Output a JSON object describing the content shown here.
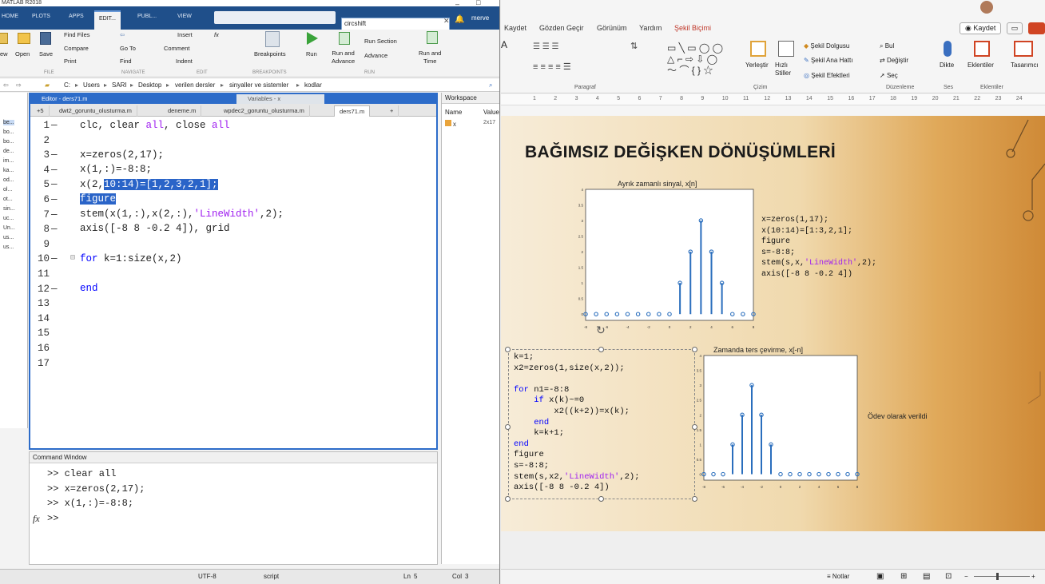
{
  "matlab": {
    "title": "MATLAB R2018",
    "tabs": [
      "HOME",
      "PLOTS",
      "APPS",
      "EDIT...",
      "PUBL...",
      "VIEW"
    ],
    "search_value": "circshift",
    "user": "merve",
    "ribbon": {
      "find_files": "Find Files",
      "compare": "Compare",
      "print": "Print",
      "insert": "Insert",
      "comment": "Comment",
      "indent": "Indent",
      "go_to": "Go To",
      "find": "Find",
      "breakpoints": "Breakpoints",
      "run": "Run",
      "run_and_advance": "Run and\nAdvance",
      "run_section": "Run Section",
      "advance": "Advance",
      "run_and_time": "Run and\nTime",
      "new": "ew",
      "open": "Open",
      "save": "Save",
      "group_file": "FILE",
      "group_navigate": "NAVIGATE",
      "group_edit": "EDIT",
      "group_breakpoints": "BREAKPOINTS",
      "group_run": "RUN"
    },
    "path": [
      "C:",
      "Users",
      "SARI",
      "Desktop",
      "verilen dersler",
      "sinyaller ve sistemler",
      "kodlar"
    ],
    "left_files": [
      "be...",
      "bo...",
      "bo...",
      "de...",
      "im...",
      "ka...",
      "od...",
      "ol...",
      "ot...",
      "sin...",
      "uc...",
      "Un...",
      "us...",
      "us..."
    ],
    "editor": {
      "header": "Editor - ders71.m",
      "variables_header": "Variables - x",
      "tabs": [
        "+5",
        "dwt2_goruntu_olusturma.m",
        "deneme.m",
        "wpdec2_goruntu_olusturma.m",
        "ders71.m",
        "+"
      ],
      "line_numbers": [
        "1",
        "2",
        "3",
        "4",
        "5",
        "6",
        "7",
        "8",
        "9",
        "10",
        "11",
        "12",
        "13",
        "14",
        "15",
        "16",
        "17"
      ],
      "code": {
        "l1_a": "clc, clear ",
        "l1_b": "all",
        "l1_c": ", close ",
        "l1_d": "all",
        "l3": "x=zeros(2,17);",
        "l4": "x(1,:)=-8:8;",
        "l5_a": "x(2,",
        "l5_b": "10:14)=[1,2,3,2,1];",
        "l6": "figure",
        "l7_a": "stem(x(1,:),x(2,:),",
        "l7_b": "'LineWidth'",
        "l7_c": ",2);",
        "l8": "axis([-8 8 -0.2 4]), grid",
        "l10_a": "for",
        "l10_b": " k=1:size(x,2)",
        "l12": "end"
      }
    },
    "workspace": {
      "header": "Workspace",
      "col_name": "Name",
      "col_value": "Value",
      "var_name": "x",
      "var_value": "2x17"
    },
    "command_window": {
      "header": "Command Window",
      "lines": [
        ">> clear all",
        ">> x=zeros(2,17);",
        ">> x(1,:)=-8:8;",
        ">>"
      ],
      "fx": "fx"
    },
    "status": {
      "encoding": "UTF-8",
      "type": "script",
      "ln_label": "Ln",
      "ln_value": "5",
      "col_label": "Col",
      "col_value": "3"
    }
  },
  "powerpoint": {
    "menu": [
      "Kaydet",
      "Gözden Geçir",
      "Görünüm",
      "Yardım",
      "Şekil Biçimi"
    ],
    "save_button": "Kaydet",
    "ribbon": {
      "paragraf": "Paragraf",
      "cizim": "Çizim",
      "duzenleme": "Düzenleme",
      "ses": "Ses",
      "eklentiler_group": "Eklentiler",
      "yerlestir": "Yerleştir",
      "hizli_stiller": "Hızlı\nStiller",
      "sekil_dolgusu": "Şekil Dolgusu",
      "sekil_ana_hatti": "Şekil Ana Hattı",
      "sekil_efektleri": "Şekil Efektleri",
      "bul": "Bul",
      "degistir": "Değiştir",
      "sec": "Seç",
      "dikte": "Dikte",
      "eklentiler": "Eklentiler",
      "tasarimci": "Tasarımcı"
    },
    "ruler": [
      "1",
      "2",
      "3",
      "4",
      "5",
      "6",
      "7",
      "8",
      "9",
      "10",
      "11",
      "12",
      "13",
      "14",
      "15",
      "16",
      "17",
      "18",
      "19",
      "20",
      "21",
      "22",
      "23",
      "24"
    ],
    "slide": {
      "title": "BAĞIMSIZ DEĞİŞKEN DÖNÜŞÜMLERİ",
      "plot1_caption": "Ayrık zamanlı sinyal, x[n]",
      "plot2_caption": "Zamanda ters çevirme, x[-n]",
      "code1": "x=zeros(1,17);\nx(10:14)=[1:3,2,1];\nfigure\ns=-8:8;\nstem(s,x,'LineWidth',2);\naxis([-8 8 -0.2 4])",
      "code2": "k=1;\nx2=zeros(1,size(x,2));\n\nfor n1=-8:8\n    if x(k)~=0\n        x2((k+2))=x(k);\n    end\n    k=k+1;\nend\nfigure\ns=-8:8;\nstem(s,x2,'LineWidth',2);\naxis([-8 8 -0.2 4])",
      "note": "Ödev olarak verildi"
    },
    "status": {
      "notes": "Notlar"
    }
  },
  "chart_data": [
    {
      "type": "scatter",
      "title": "Ayrık zamanlı sinyal, x[n]",
      "x": [
        -8,
        -7,
        -6,
        -5,
        -4,
        -3,
        -2,
        -1,
        0,
        1,
        2,
        3,
        4,
        5,
        6,
        7,
        8
      ],
      "y": [
        0,
        0,
        0,
        0,
        0,
        0,
        0,
        0,
        0,
        1,
        2,
        3,
        2,
        1,
        0,
        0,
        0
      ],
      "xlim": [
        -8,
        8
      ],
      "ylim": [
        -0.2,
        4
      ],
      "yticks": [
        "0",
        "0.5",
        "1",
        "1.5",
        "2",
        "2.5",
        "3",
        "3.5",
        "4"
      ],
      "xticks": [
        "-8",
        "-6",
        "-4",
        "-2",
        "0",
        "2",
        "4",
        "6",
        "8"
      ],
      "color": "#2a6ebd"
    },
    {
      "type": "scatter",
      "title": "Zamanda ters çevirme, x[-n]",
      "x": [
        -8,
        -7,
        -6,
        -5,
        -4,
        -3,
        -2,
        -1,
        0,
        1,
        2,
        3,
        4,
        5,
        6,
        7,
        8
      ],
      "y": [
        0,
        0,
        0,
        1,
        2,
        3,
        2,
        1,
        0,
        0,
        0,
        0,
        0,
        0,
        0,
        0,
        0
      ],
      "xlim": [
        -8,
        8
      ],
      "ylim": [
        -0.2,
        4
      ],
      "yticks": [
        "0",
        "0.5",
        "1",
        "1.5",
        "2",
        "2.5",
        "3",
        "3.5",
        "4"
      ],
      "xticks": [
        "-8",
        "-6",
        "-4",
        "-2",
        "0",
        "2",
        "4",
        "6",
        "8"
      ],
      "color": "#2a6ebd"
    }
  ]
}
